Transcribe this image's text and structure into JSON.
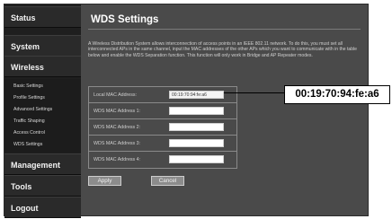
{
  "sidebar": {
    "status": "Status",
    "system": "System",
    "wireless": "Wireless",
    "wireless_items": [
      "Basic Settings",
      "Profile Settings",
      "Advanced Settings",
      "Traffic Shaping",
      "Access Control",
      "WDS Settings"
    ],
    "management": "Management",
    "tools": "Tools",
    "logout": "Logout"
  },
  "page": {
    "title": "WDS Settings",
    "description": "A Wireless Distribution System allows interconnection of access points in an IEEE 802.11 network. To do this, you must set all interconnected APs in the same channel, input the MAC addresses of the other APs which you want to communicate with in the table below and enable the WDS Separation function. This function will only work in Bridge and AP Repeater modes."
  },
  "form": {
    "rows": [
      {
        "label": "Local MAC Address:",
        "value": "00:19:70:94:fe:a6"
      },
      {
        "label": "WDS MAC Address 1:",
        "value": ""
      },
      {
        "label": "WDS MAC Address 2:",
        "value": ""
      },
      {
        "label": "WDS MAC Address 3:",
        "value": ""
      },
      {
        "label": "WDS MAC Address 4:",
        "value": ""
      }
    ]
  },
  "buttons": {
    "apply": "Apply",
    "cancel": "Cancel"
  },
  "callout": {
    "text": "00:19:70:94:fe:a6"
  }
}
